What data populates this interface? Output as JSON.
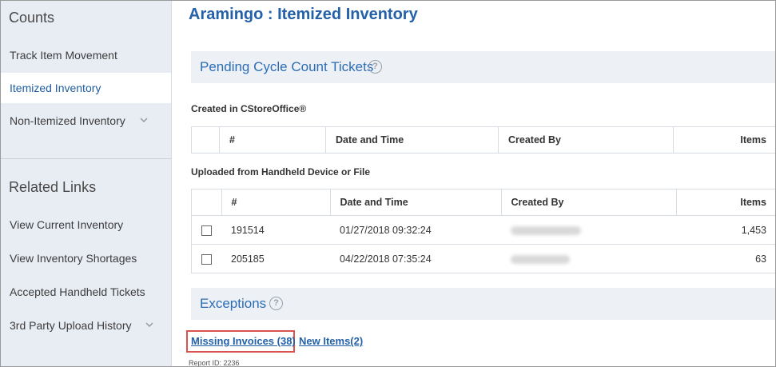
{
  "sidebar": {
    "counts_heading": "Counts",
    "counts_items": [
      {
        "label": "Track Item Movement"
      },
      {
        "label": "Itemized Inventory"
      },
      {
        "label": "Non-Itemized Inventory"
      }
    ],
    "related_heading": "Related Links",
    "related_items": [
      {
        "label": "View Current Inventory"
      },
      {
        "label": "View Inventory Shortages"
      },
      {
        "label": "Accepted Handheld Tickets"
      },
      {
        "label": "3rd Party Upload History"
      }
    ]
  },
  "main": {
    "title": "Aramingo : Itemized Inventory",
    "pending_section": {
      "title": "Pending Cycle Count Tickets",
      "help_glyph": "?"
    },
    "created_table": {
      "label": "Created in CStoreOffice®",
      "columns": [
        "",
        "#",
        "Date and Time",
        "Created By",
        "Items"
      ]
    },
    "uploaded_table": {
      "label": "Uploaded from Handheld Device or File",
      "columns": [
        "",
        "#",
        "Date and Time",
        "Created By",
        "Items"
      ],
      "rows": [
        {
          "id": "191514",
          "datetime": "01/27/2018 09:32:24",
          "created_by": "",
          "items": "1,453"
        },
        {
          "id": "205185",
          "datetime": "04/22/2018 07:35:24",
          "created_by": "",
          "items": "63"
        }
      ]
    },
    "exceptions_section": {
      "title": "Exceptions",
      "help_glyph": "?"
    },
    "links": {
      "missing_invoices": "Missing Invoices (38)",
      "new_items": "New Items(2)"
    },
    "report_id": "Report ID: 2236"
  },
  "colors": {
    "accent": "#2461a8",
    "sidebar_bg": "#e8ecf3",
    "band_bg": "#edf1f6",
    "highlight": "#d9534f"
  }
}
